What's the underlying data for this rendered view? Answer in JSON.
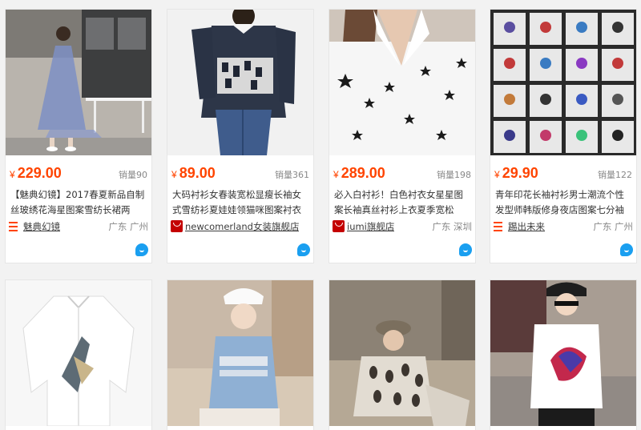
{
  "colors": {
    "price": "#ff4400",
    "accent": "#1a9ff0",
    "tmall": "#c40000"
  },
  "items": [
    {
      "price": "229.00",
      "sales": "销量90",
      "title": "【魅典幻镜】2017春夏新品自制丝玻绣花海星图案雪纺长裙两",
      "shop": "魅典幻镜",
      "location": "广东 广州"
    },
    {
      "price": "89.00",
      "sales": "销量361",
      "title": "大码衬衫女春装宽松显瘦长袖女式雪纺衫夏娃娃领猫咪图案衬衣",
      "shop": "newcomerland女装旗舰店",
      "location": ""
    },
    {
      "price": "289.00",
      "sales": "销量198",
      "title": "必入白衬衫！白色衬衣女星星图案长袖真丝衬衫上衣夏季宽松",
      "shop": "iumi旗舰店",
      "location": "广东 深圳"
    },
    {
      "price": "29.90",
      "sales": "销量122",
      "title": "青年印花长袖衬衫男士潮流个性发型师韩版修身夜店图案七分袖",
      "shop": "踢出未来",
      "location": "广东 广州"
    }
  ],
  "currency": "¥"
}
